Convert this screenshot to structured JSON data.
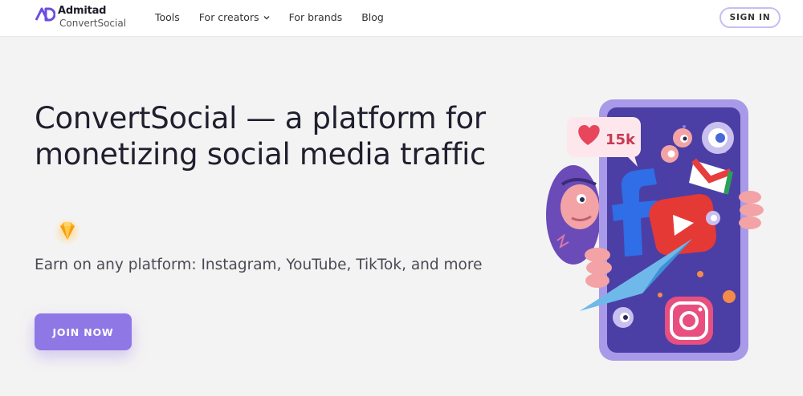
{
  "header": {
    "logo": {
      "name": "Admitad",
      "sub": "ConvertSocial"
    },
    "nav": [
      {
        "label": "Tools"
      },
      {
        "label": "For creators",
        "has_dropdown": true
      },
      {
        "label": "For brands"
      },
      {
        "label": "Blog"
      }
    ],
    "signin_label": "SIGN IN"
  },
  "hero": {
    "title": "ConvertSocial — a platform for monetizing social media traffic",
    "subtitle": "Earn on any platform: Instagram, YouTube, TikTok, and more",
    "cta_label": "JOIN NOW"
  },
  "illustration": {
    "like_count": "15k",
    "icons": [
      "heart-icon",
      "facebook-icon",
      "youtube-icon",
      "gmail-icon",
      "instagram-icon",
      "paper-plane-icon",
      "gem-icon"
    ]
  },
  "colors": {
    "accent": "#8f78e6",
    "signin_border": "#c8bdf3",
    "background": "#f4f3f3",
    "phone": "#a89ae8",
    "screen": "#4b3fa6"
  }
}
